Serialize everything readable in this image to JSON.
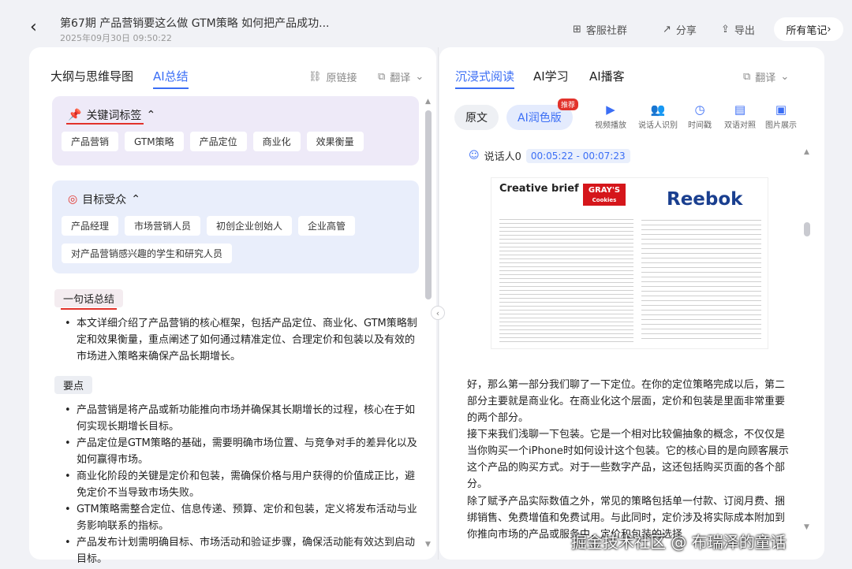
{
  "header": {
    "title": "第67期 产品营销要这么做 GTM策略 如何把产品成功...",
    "date": "2025年09月30日 09:50:22",
    "back_icon": "‹",
    "actions": [
      {
        "icon": "grid-icon",
        "label": "客服社群"
      },
      {
        "icon": "share-icon",
        "label": "分享"
      },
      {
        "icon": "export-icon",
        "label": "导出"
      }
    ],
    "all_notes": "所有笔记"
  },
  "left": {
    "tabs": [
      "大纲与思维导图",
      "AI总结"
    ],
    "source_link": "原链接",
    "translate": "翻译",
    "keywords": {
      "title": "关键词标签",
      "tags": [
        "产品营销",
        "GTM策略",
        "产品定位",
        "商业化",
        "效果衡量"
      ]
    },
    "audience": {
      "title": "目标受众",
      "tags": [
        "产品经理",
        "市场营销人员",
        "初创企业创始人",
        "企业高管",
        "对产品营销感兴趣的学生和研究人员"
      ]
    },
    "summary": {
      "label": "一句话总结",
      "text": "本文详细介绍了产品营销的核心框架，包括产品定位、商业化、GTM策略制定和效果衡量，重点阐述了如何通过精准定位、合理定价和包装以及有效的市场进入策略来确保产品长期增长。"
    },
    "keypoints": {
      "label": "要点",
      "items": [
        "产品营销是将产品或新功能推向市场并确保其长期增长的过程，核心在于如何实现长期增长目标。",
        "产品定位是GTM策略的基础，需要明确市场位置、与竞争对手的差异化以及如何赢得市场。",
        "商业化阶段的关键是定价和包装，需确保价格与用户获得的价值成正比，避免定价不当导致市场失败。",
        "GTM策略需整合定位、信息传递、预算、定价和包装，定义将发布活动与业务影响联系的指标。",
        "产品发布计划需明确目标、市场活动和验证步骤，确保活动能有效达到启动目标。"
      ]
    }
  },
  "right": {
    "tabs": [
      "沉浸式阅读",
      "AI学习",
      "AI播客"
    ],
    "translate": "翻译",
    "original": "原文",
    "ai_polish": "AI润色版",
    "badge": "推荐",
    "features": [
      {
        "icon": "video-icon",
        "label": "视频播放"
      },
      {
        "icon": "speaker-id-icon",
        "label": "说话人识别"
      },
      {
        "icon": "clock-icon",
        "label": "时间戳"
      },
      {
        "icon": "bilingual-icon",
        "label": "双语对照"
      },
      {
        "icon": "image-icon",
        "label": "图片展示"
      }
    ],
    "speaker": "说话人0",
    "timestamp": "00:05:22 - 00:07:23",
    "slide": {
      "title": "Creative brief",
      "brand1": "GRAY'S",
      "brand1_sub": "Cookies",
      "brand2": "Reebok"
    },
    "paragraphs": [
      "好，那么第一部分我们聊了一下定位。在你的定位策略完成以后，第二部分主要就是商业化。在商业化这个层面，定价和包装是里面非常重要的两个部分。",
      "接下来我们浅聊一下包装。它是一个相对比较偏抽象的概念，不仅仅是当你购买一个iPhone时如何设计这个包装。它的核心目的是向顾客展示这个产品的购买方式。对于一些数字产品，这还包括购买页面的各个部分。",
      "除了赋予产品实际数值之外，常见的策略包括单一付款、订阅月费、捆绑销售、免费增值和免费试用。与此同时，定价涉及将实际成本附加到你推向市场的产品或服务中，定价和包装的选择"
    ]
  },
  "watermark": "掘金技术社区 @ 布瑞泽的童话"
}
